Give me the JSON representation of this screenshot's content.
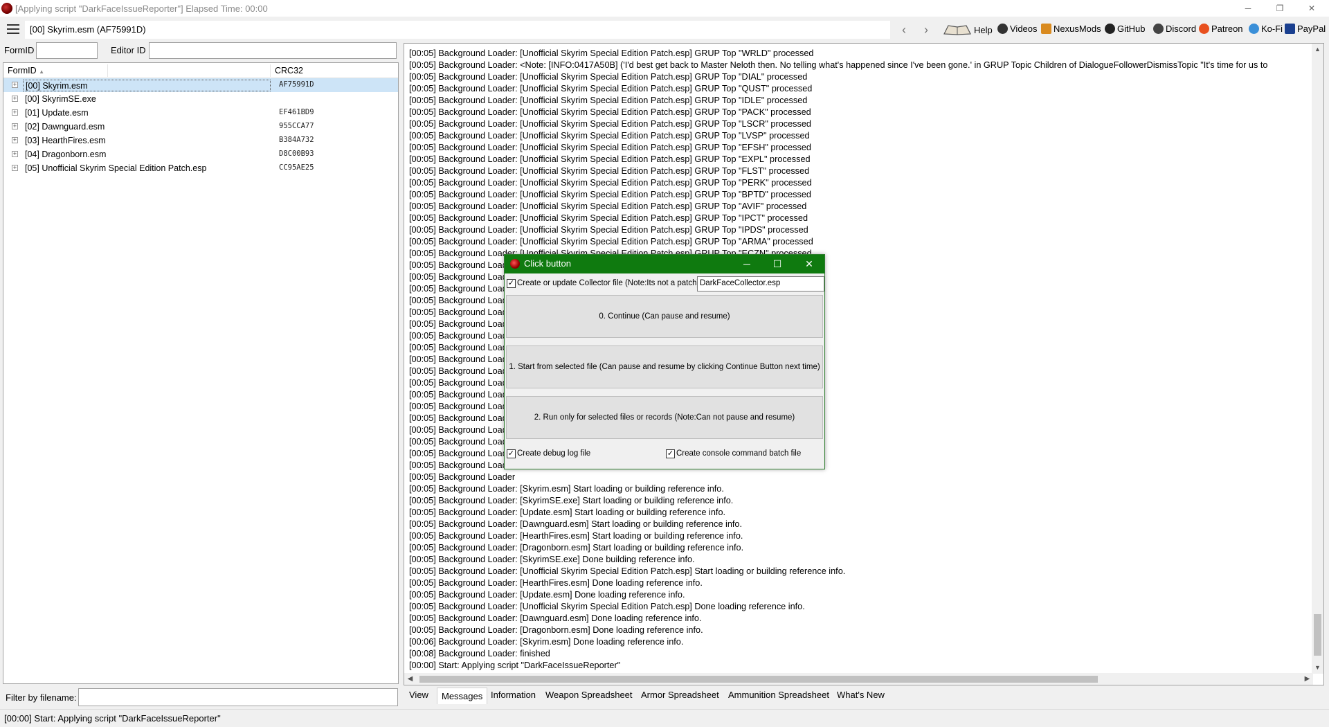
{
  "window": {
    "title": "[Applying script \"DarkFaceIssueReporter\"] Elapsed Time: 00:00",
    "minimize": "─",
    "restore": "❐",
    "close": "✕"
  },
  "toolbar": {
    "path": "[00] Skyrim.esm (AF75991D)",
    "back": "‹",
    "forward": "›",
    "links": [
      "Help",
      "Videos",
      "NexusMods",
      "GitHub",
      "Discord",
      "Patreon",
      "Ko-Fi",
      "PayPal"
    ]
  },
  "filters": {
    "formid_label": "FormID",
    "editorid_label": "Editor ID",
    "filename_label": "Filter by filename:"
  },
  "tree": {
    "columns": [
      "FormID",
      "CRC32"
    ],
    "rows": [
      {
        "name": "[00] Skyrim.esm",
        "crc": "AF75991D"
      },
      {
        "name": "[00] SkyrimSE.exe",
        "crc": ""
      },
      {
        "name": "[01] Update.esm",
        "crc": "EF461BD9"
      },
      {
        "name": "[02] Dawnguard.esm",
        "crc": "955CCA77"
      },
      {
        "name": "[03] HearthFires.esm",
        "crc": "B384A732"
      },
      {
        "name": "[04] Dragonborn.esm",
        "crc": "D8C00B93"
      },
      {
        "name": "[05] Unofficial Skyrim Special Edition Patch.esp",
        "crc": "CC95AE25"
      }
    ]
  },
  "log": [
    "[00:05] Background Loader: [Unofficial Skyrim Special Edition Patch.esp] GRUP Top \"WRLD\" processed",
    "[00:05] Background Loader: <Note: [INFO:0417A50B] ('I'd best get back to Master Neloth then. No telling what's happened since I've been gone.' in GRUP Topic Children of DialogueFollowerDismissTopic \"It's time for us to",
    "[00:05] Background Loader: [Unofficial Skyrim Special Edition Patch.esp] GRUP Top \"DIAL\" processed",
    "[00:05] Background Loader: [Unofficial Skyrim Special Edition Patch.esp] GRUP Top \"QUST\" processed",
    "[00:05] Background Loader: [Unofficial Skyrim Special Edition Patch.esp] GRUP Top \"IDLE\" processed",
    "[00:05] Background Loader: [Unofficial Skyrim Special Edition Patch.esp] GRUP Top \"PACK\" processed",
    "[00:05] Background Loader: [Unofficial Skyrim Special Edition Patch.esp] GRUP Top \"LSCR\" processed",
    "[00:05] Background Loader: [Unofficial Skyrim Special Edition Patch.esp] GRUP Top \"LVSP\" processed",
    "[00:05] Background Loader: [Unofficial Skyrim Special Edition Patch.esp] GRUP Top \"EFSH\" processed",
    "[00:05] Background Loader: [Unofficial Skyrim Special Edition Patch.esp] GRUP Top \"EXPL\" processed",
    "[00:05] Background Loader: [Unofficial Skyrim Special Edition Patch.esp] GRUP Top \"FLST\" processed",
    "[00:05] Background Loader: [Unofficial Skyrim Special Edition Patch.esp] GRUP Top \"PERK\" processed",
    "[00:05] Background Loader: [Unofficial Skyrim Special Edition Patch.esp] GRUP Top \"BPTD\" processed",
    "[00:05] Background Loader: [Unofficial Skyrim Special Edition Patch.esp] GRUP Top \"AVIF\" processed",
    "[00:05] Background Loader: [Unofficial Skyrim Special Edition Patch.esp] GRUP Top \"IPCT\" processed",
    "[00:05] Background Loader: [Unofficial Skyrim Special Edition Patch.esp] GRUP Top \"IPDS\" processed",
    "[00:05] Background Loader: [Unofficial Skyrim Special Edition Patch.esp] GRUP Top \"ARMA\" processed",
    "[00:05] Background Loader: [Unofficial Skyrim Special Edition Patch.esp] GRUP Top \"ECZN\" processed",
    "[00:05] Background Loader",
    "[00:05] Background Loader",
    "[00:05] Background Loader",
    "[00:05] Background Loader",
    "[00:05] Background Loader",
    "[00:05] Background Loader",
    "[00:05] Background Loader",
    "[00:05] Background Loader",
    "[00:05] Background Loader",
    "[00:05] Background Loader",
    "[00:05] Background Loader",
    "[00:05] Background Loader",
    "[00:05] Background Loader",
    "[00:05] Background Loader",
    "[00:05] Background Loader",
    "[00:05] Background Loader",
    "[00:05] Background Loader",
    "[00:05] Background Loader",
    "[00:05] Background Loader",
    "[00:05] Background Loader: [Skyrim.esm] Start loading or building reference info.",
    "[00:05] Background Loader: [SkyrimSE.exe] Start loading or building reference info.",
    "[00:05] Background Loader: [Update.esm] Start loading or building reference info.",
    "[00:05] Background Loader: [Dawnguard.esm] Start loading or building reference info.",
    "[00:05] Background Loader: [HearthFires.esm] Start loading or building reference info.",
    "[00:05] Background Loader: [Dragonborn.esm] Start loading or building reference info.",
    "[00:05] Background Loader: [SkyrimSE.exe] Done building reference info.",
    "[00:05] Background Loader: [Unofficial Skyrim Special Edition Patch.esp] Start loading or building reference info.",
    "[00:05] Background Loader: [HearthFires.esm] Done loading reference info.",
    "[00:05] Background Loader: [Update.esm] Done loading reference info.",
    "[00:05] Background Loader: [Unofficial Skyrim Special Edition Patch.esp] Done loading reference info.",
    "[00:05] Background Loader: [Dawnguard.esm] Done loading reference info.",
    "[00:05] Background Loader: [Dragonborn.esm] Done loading reference info.",
    "[00:06] Background Loader: [Skyrim.esm] Done loading reference info.",
    "[00:08] Background Loader: finished",
    "[00:00] Start: Applying script \"DarkFaceIssueReporter\""
  ],
  "tabs": [
    "View",
    "Messages",
    "Information",
    "Weapon Spreadsheet",
    "Armor Spreadsheet",
    "Ammunition Spreadsheet",
    "What's New"
  ],
  "active_tab": "Messages",
  "status": "[00:00] Start: Applying script \"DarkFaceIssueReporter\"",
  "dialog": {
    "title": "Click button",
    "collector_label": "Create or update Collector file (Note:Its not a patch) :",
    "collector_value": "DarkFaceCollector.esp",
    "collector_checked": true,
    "buttons": [
      "0. Continue (Can pause and resume)",
      "1. Start from selected file (Can pause and resume by clicking Continue Button next time)",
      "2. Run only for selected files or records (Note:Can not pause and resume)"
    ],
    "debug_label": "Create debug log file",
    "debug_checked": true,
    "console_label": "Create console command batch file",
    "console_checked": true,
    "minimize": "─",
    "maximize": "☐",
    "close": "✕"
  },
  "colors": {
    "dialog_title_bg": "#0f7a0f",
    "selection": "#cde4f7"
  }
}
